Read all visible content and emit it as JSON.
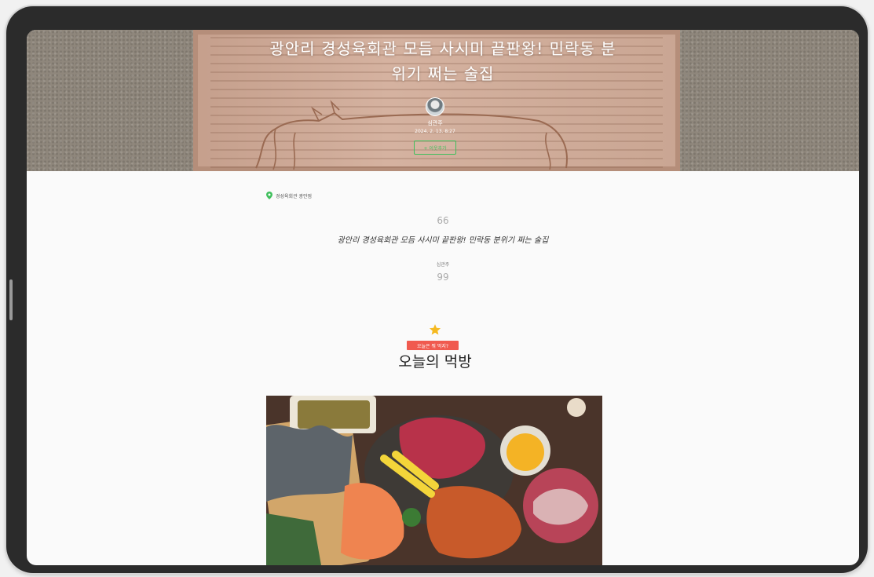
{
  "post": {
    "title": "광안리 경성육회관 모듬 사시미 끝판왕! 민락동 분위기 쩌는 술집",
    "author": "심관주",
    "date": "2024. 2. 13. 8:27",
    "follow_label": "+ 이웃추가"
  },
  "location": {
    "name": "경성육회관 광안점"
  },
  "quote": {
    "open_mark": "66",
    "text": "광안리 경성육회관 모듬 사시미 끝판왕! 민락동 분위기 쩌는 술집",
    "author": "심관주",
    "close_mark": "99"
  },
  "section": {
    "tag": "오늘은 뭐 먹지?",
    "title": "오늘의 먹방"
  },
  "colors": {
    "accent_green": "#3fbf5c",
    "badge_red": "#f05a4f",
    "star": "#f5b920"
  },
  "icons": {
    "location": "map-pin-icon",
    "star": "star-icon"
  }
}
